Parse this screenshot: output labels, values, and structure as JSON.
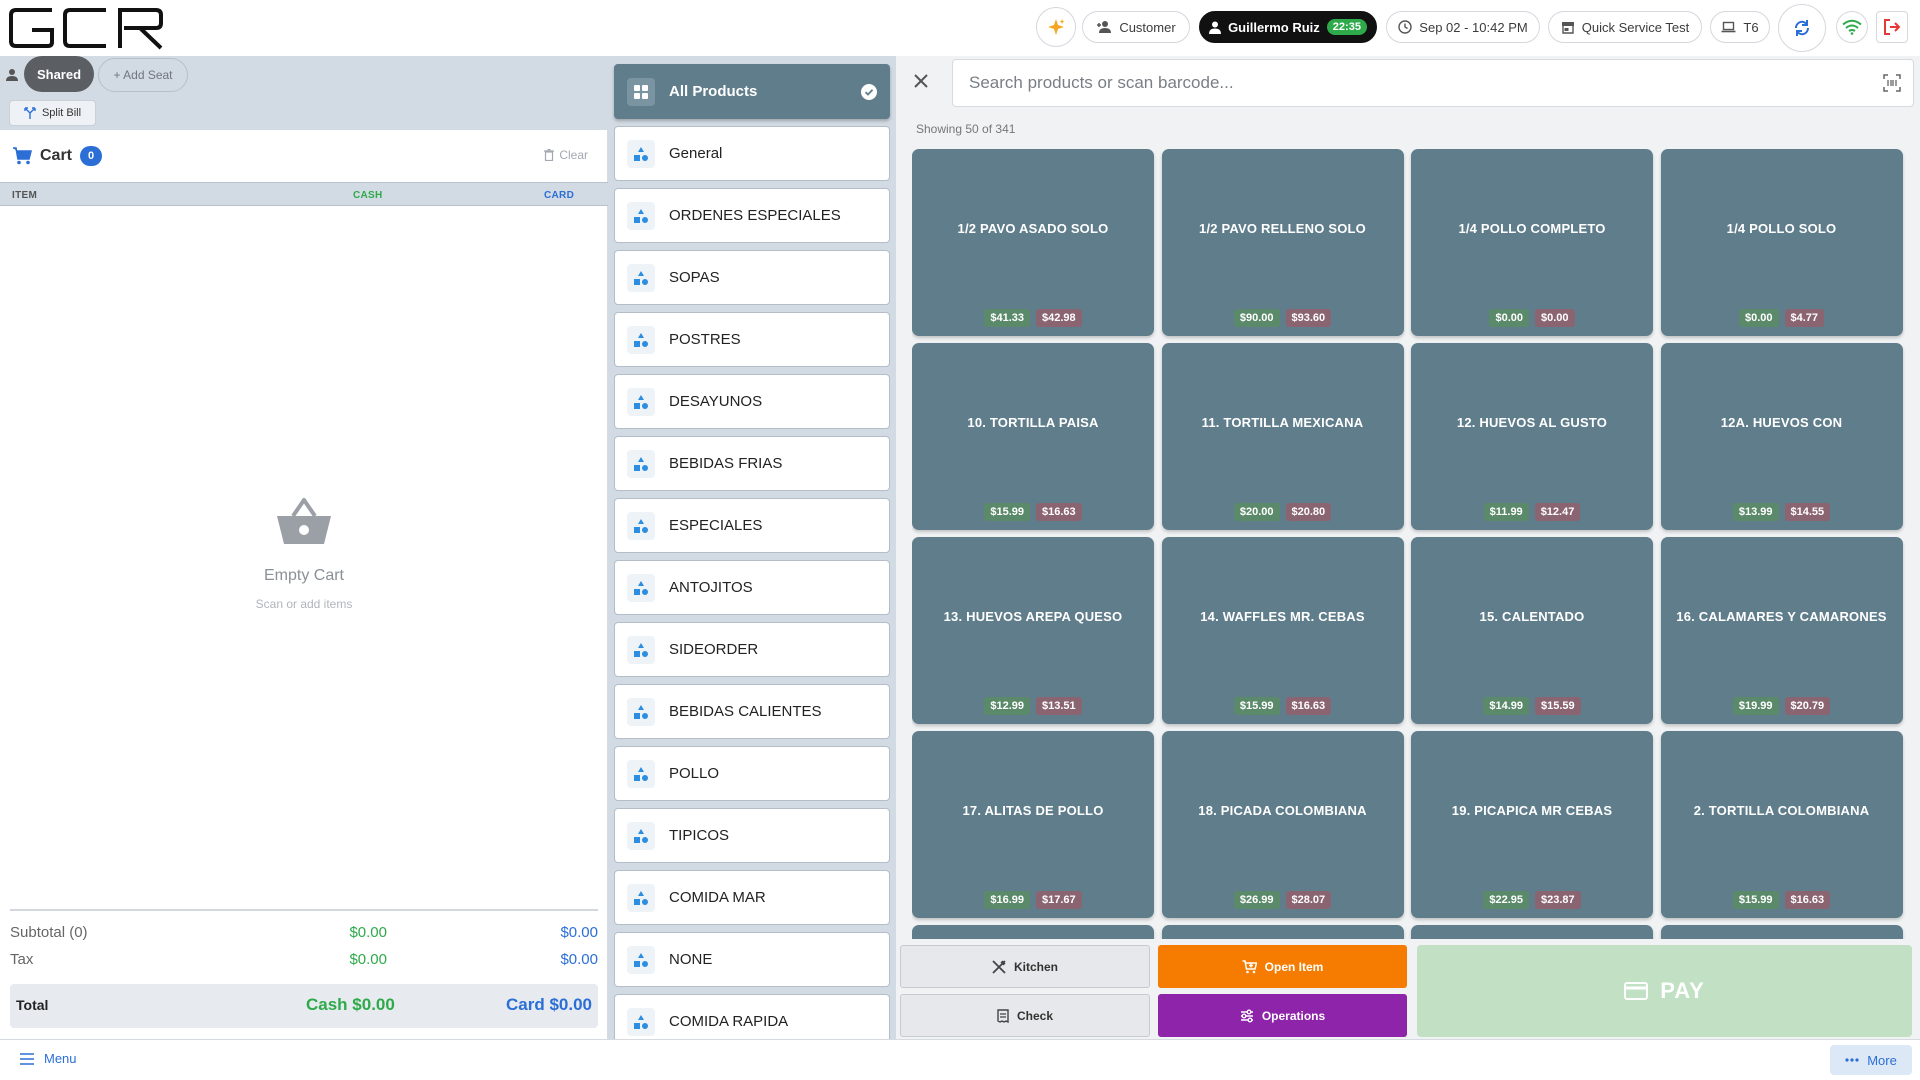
{
  "header": {
    "logo_text": "GCR",
    "customer_label": "Customer",
    "user_name": "Guillermo Ruiz",
    "session_time": "22:35",
    "datetime": "Sep 02 - 10:42 PM",
    "store_name": "Quick Service Test",
    "table_label": "T6"
  },
  "seats": {
    "shared_label": "Shared",
    "add_seat_label": "+ Add Seat",
    "split_bill_label": "Split Bill"
  },
  "cart": {
    "title": "Cart",
    "count": "0",
    "clear_label": "Clear",
    "columns": {
      "item": "ITEM",
      "cash": "CASH",
      "card": "CARD"
    },
    "empty_title": "Empty Cart",
    "empty_subtitle": "Scan or add items",
    "subtotal_label": "Subtotal (0)",
    "subtotal_cash": "$0.00",
    "subtotal_card": "$0.00",
    "tax_label": "Tax",
    "tax_cash": "$0.00",
    "tax_card": "$0.00",
    "total_label": "Total",
    "total_cash": "Cash $0.00",
    "total_card": "Card $0.00"
  },
  "categories": {
    "active": "All Products",
    "items": [
      "General",
      "ORDENES ESPECIALES",
      "SOPAS",
      "POSTRES",
      "DESAYUNOS",
      "BEBIDAS FRIAS",
      "ESPECIALES",
      "ANTOJITOS",
      "SIDEORDER",
      "BEBIDAS CALIENTES",
      "POLLO",
      "TIPICOS",
      "COMIDA MAR",
      "NONE",
      "COMIDA RAPIDA"
    ]
  },
  "search": {
    "placeholder": "Search products or scan barcode...",
    "showing": "Showing 50 of 341"
  },
  "products": [
    {
      "name": "1/2 PAVO ASADO SOLO",
      "cash": "$41.33",
      "card": "$42.98"
    },
    {
      "name": "1/2 PAVO RELLENO SOLO",
      "cash": "$90.00",
      "card": "$93.60"
    },
    {
      "name": "1/4 POLLO COMPLETO",
      "cash": "$0.00",
      "card": "$0.00"
    },
    {
      "name": "1/4 POLLO SOLO",
      "cash": "$0.00",
      "card": "$4.77"
    },
    {
      "name": "10. TORTILLA PAISA",
      "cash": "$15.99",
      "card": "$16.63"
    },
    {
      "name": "11. TORTILLA MEXICANA",
      "cash": "$20.00",
      "card": "$20.80"
    },
    {
      "name": "12. HUEVOS AL GUSTO",
      "cash": "$11.99",
      "card": "$12.47"
    },
    {
      "name": "12A. HUEVOS CON",
      "cash": "$13.99",
      "card": "$14.55"
    },
    {
      "name": "13. HUEVOS AREPA QUESO",
      "cash": "$12.99",
      "card": "$13.51"
    },
    {
      "name": "14. WAFFLES  MR. CEBAS",
      "cash": "$15.99",
      "card": "$16.63"
    },
    {
      "name": "15. CALENTADO",
      "cash": "$14.99",
      "card": "$15.59"
    },
    {
      "name": "16. CALAMARES Y CAMARONES",
      "cash": "$19.99",
      "card": "$20.79"
    },
    {
      "name": "17. ALITAS  DE POLLO",
      "cash": "$16.99",
      "card": "$17.67"
    },
    {
      "name": "18. PICADA COLOMBIANA",
      "cash": "$26.99",
      "card": "$28.07"
    },
    {
      "name": "19. PICAPICA MR CEBAS",
      "cash": "$22.95",
      "card": "$23.87"
    },
    {
      "name": "2. TORTILLA COLOMBIANA",
      "cash": "$15.99",
      "card": "$16.63"
    }
  ],
  "actions": {
    "kitchen": "Kitchen",
    "open_item": "Open Item",
    "check": "Check",
    "operations": "Operations",
    "pay": "PAY"
  },
  "footer": {
    "menu_label": "Menu",
    "more_label": "More"
  },
  "colors": {
    "tile_bg": "#607d8b",
    "cash": "#2eaa4a",
    "card": "#2b6fd6",
    "open_item": "#f57c00",
    "operations": "#8e24aa",
    "pay_disabled": "#c2e0c4"
  }
}
